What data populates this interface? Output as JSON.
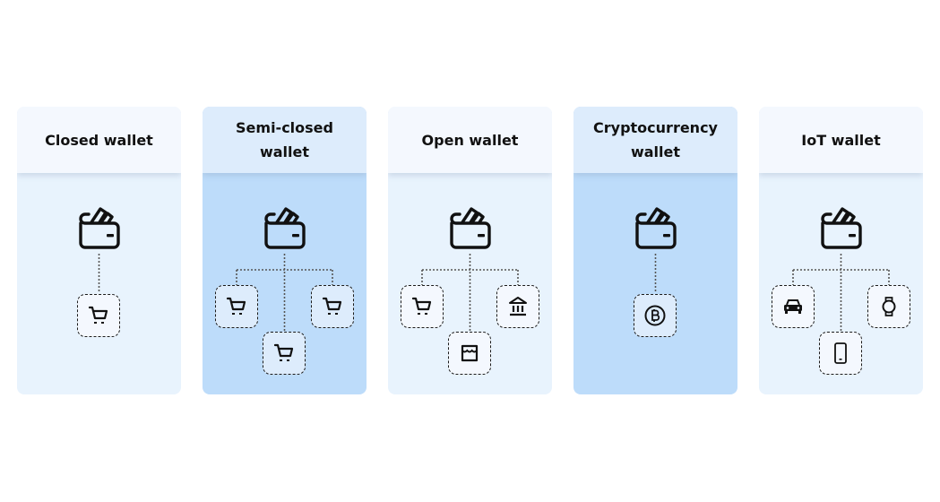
{
  "cards": [
    {
      "title": "Closed wallet",
      "theme": "light",
      "children": [
        "shopping-cart"
      ]
    },
    {
      "title": "Semi-closed\nwallet",
      "theme": "dark",
      "children": [
        "shopping-cart",
        "shopping-cart",
        "shopping-cart"
      ]
    },
    {
      "title": "Open wallet",
      "theme": "light",
      "children": [
        "shopping-cart",
        "store",
        "bank"
      ]
    },
    {
      "title": "Cryptocurrency\nwallet",
      "theme": "dark",
      "children": [
        "bitcoin"
      ]
    },
    {
      "title": "IoT wallet",
      "theme": "light",
      "children": [
        "car",
        "smartphone",
        "smartwatch"
      ]
    }
  ],
  "colors": {
    "light_body": "#e8f3fd",
    "light_head": "#f4f8fe",
    "dark_body": "#bddcfa",
    "dark_head": "#ddecfc",
    "ink": "#111111"
  }
}
